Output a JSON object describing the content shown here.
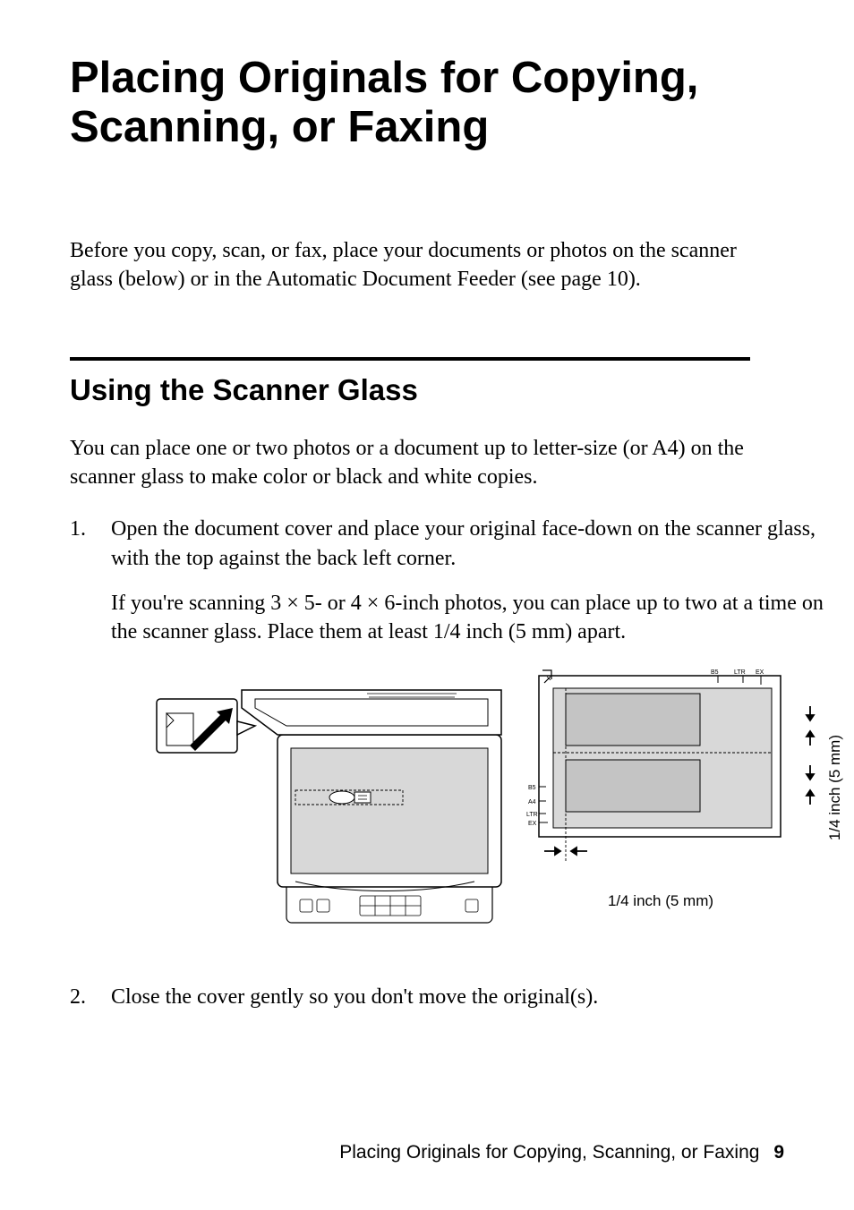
{
  "title": "Placing Originals for Copying, Scanning, or Faxing",
  "intro": "Before you copy, scan, or fax, place your documents or photos on the scanner glass (below) or in the Automatic Document Feeder (see page 10).",
  "section": {
    "heading": "Using the Scanner Glass",
    "intro": "You can place one or two photos or a document up to letter-size (or A4) on the scanner glass to make color or black and white copies.",
    "steps": [
      {
        "num": "1.",
        "paras": [
          "Open the document cover and place your original face-down on the scanner glass, with the top against the back left corner.",
          "If you're scanning 3 × 5- or 4 × 6-inch photos, you can place up to two at a time on the scanner glass. Place them at least 1/4 inch (5 mm) apart."
        ]
      },
      {
        "num": "2.",
        "paras": [
          "Close the cover gently so you don't move the original(s)."
        ]
      }
    ]
  },
  "figure": {
    "gap_label_h": "1/4 inch (5 mm)",
    "gap_label_v": "1/4 inch (5 mm)",
    "size_marks": {
      "top": [
        "B5",
        "LTR",
        "EX"
      ],
      "left": [
        "B5",
        "A4",
        "LTR",
        "EX"
      ]
    }
  },
  "footer": {
    "text": "Placing Originals for Copying, Scanning, or Faxing",
    "page": "9"
  }
}
